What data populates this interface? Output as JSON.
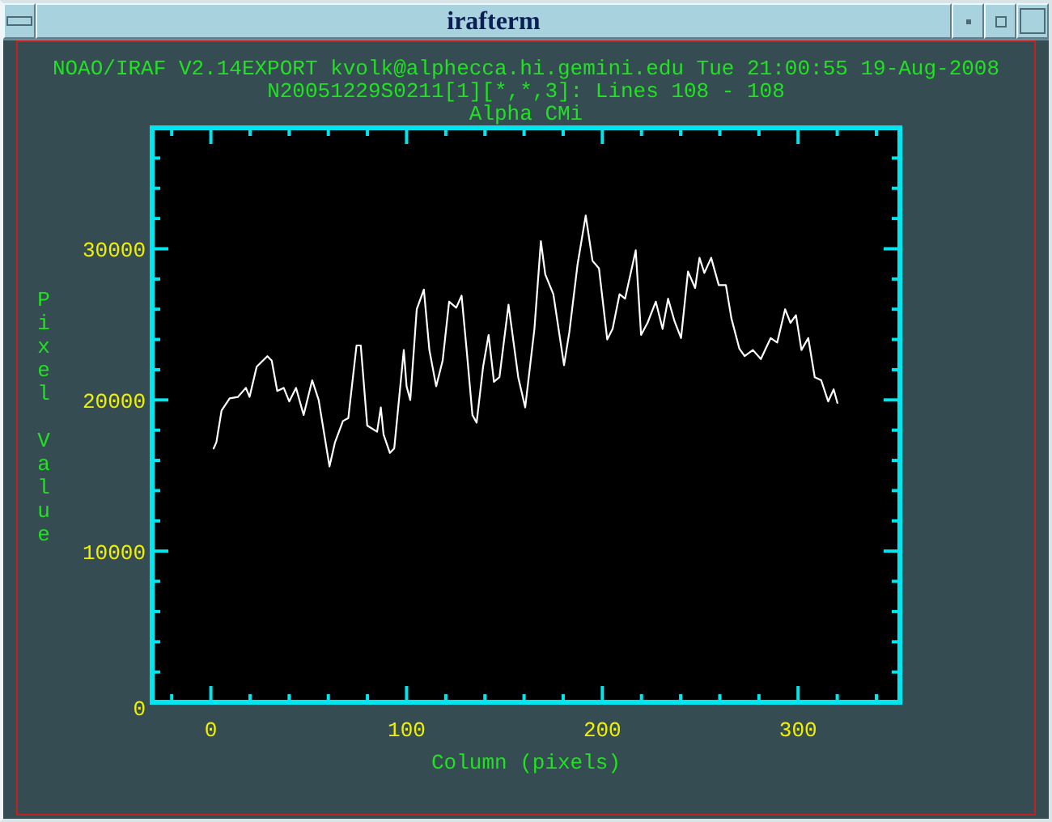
{
  "window": {
    "title": "irafterm"
  },
  "header": {
    "lines": [
      "NOAO/IRAF V2.14EXPORT kvolk@alphecca.hi.gemini.edu Tue 21:00:55 19-Aug-2008",
      "N20051229S0211[1][*,*,3]: Lines 108 - 108"
    ]
  },
  "plot": {
    "chart_data": {
      "type": "line",
      "title": "Alpha CMi",
      "xlabel": "Column (pixels)",
      "ylabel": "Pixel Value",
      "xlim": [
        -30,
        352
      ],
      "ylim": [
        0,
        38000
      ],
      "xticks": [
        0,
        100,
        200,
        300
      ],
      "yticks": [
        0,
        10000,
        20000,
        30000
      ],
      "x": [
        1.4,
        2.8,
        5.5,
        9.6,
        13.8,
        17.9,
        19.8,
        23.4,
        28.9,
        31.1,
        33.9,
        37.2,
        40,
        43.5,
        47.4,
        51.8,
        55.1,
        60.6,
        63.4,
        67.5,
        70.2,
        74.4,
        76.6,
        79.9,
        84.9,
        86.8,
        88.2,
        91.5,
        93.7,
        98.6,
        100,
        101.9,
        105.2,
        108.8,
        111.6,
        115.1,
        118.4,
        121.7,
        125.4,
        128.1,
        130.8,
        133.6,
        135.8,
        139.1,
        141.9,
        144.6,
        147.4,
        152.1,
        157,
        160.6,
        165.3,
        168.6,
        170.8,
        175,
        180.4,
        183.2,
        187.4,
        191.5,
        195,
        198.3,
        202.5,
        205.2,
        208.8,
        211.6,
        217.1,
        219.8,
        223.1,
        227.3,
        230.8,
        233.6,
        236.9,
        240.2,
        243.8,
        247.4,
        249.6,
        252.1,
        255.6,
        259.5,
        263.1,
        265.9,
        270,
        272.7,
        276.9,
        281,
        286,
        289.3,
        293.4,
        296.1,
        298.9,
        301.7,
        305.2,
        308.5,
        311.8,
        315.4,
        318.2,
        320.1
      ],
      "series": [
        {
          "color": "#ffffff",
          "values": [
            16800,
            17200,
            19300,
            20100,
            20200,
            20800,
            20200,
            22200,
            22900,
            22600,
            20600,
            20800,
            19900,
            20800,
            19000,
            21300,
            20000,
            15600,
            17200,
            18600,
            18800,
            23600,
            23600,
            18300,
            17900,
            19500,
            17700,
            16500,
            16800,
            23300,
            20900,
            20000,
            26000,
            27300,
            23300,
            20900,
            22600,
            26500,
            26100,
            26900,
            23100,
            19000,
            18500,
            22200,
            24300,
            21200,
            21500,
            26300,
            21500,
            19500,
            24700,
            30500,
            28300,
            27000,
            22300,
            24500,
            29000,
            32200,
            29200,
            28700,
            24000,
            24700,
            27000,
            26700,
            29900,
            24300,
            25100,
            26500,
            24700,
            26700,
            25200,
            24100,
            28500,
            27400,
            29400,
            28400,
            29400,
            27600,
            27600,
            25400,
            23400,
            22900,
            23300,
            22700,
            24100,
            23800,
            26000,
            25100,
            25600,
            23300,
            24100,
            21500,
            21300,
            19900,
            20700,
            19800
          ]
        }
      ]
    }
  }
}
